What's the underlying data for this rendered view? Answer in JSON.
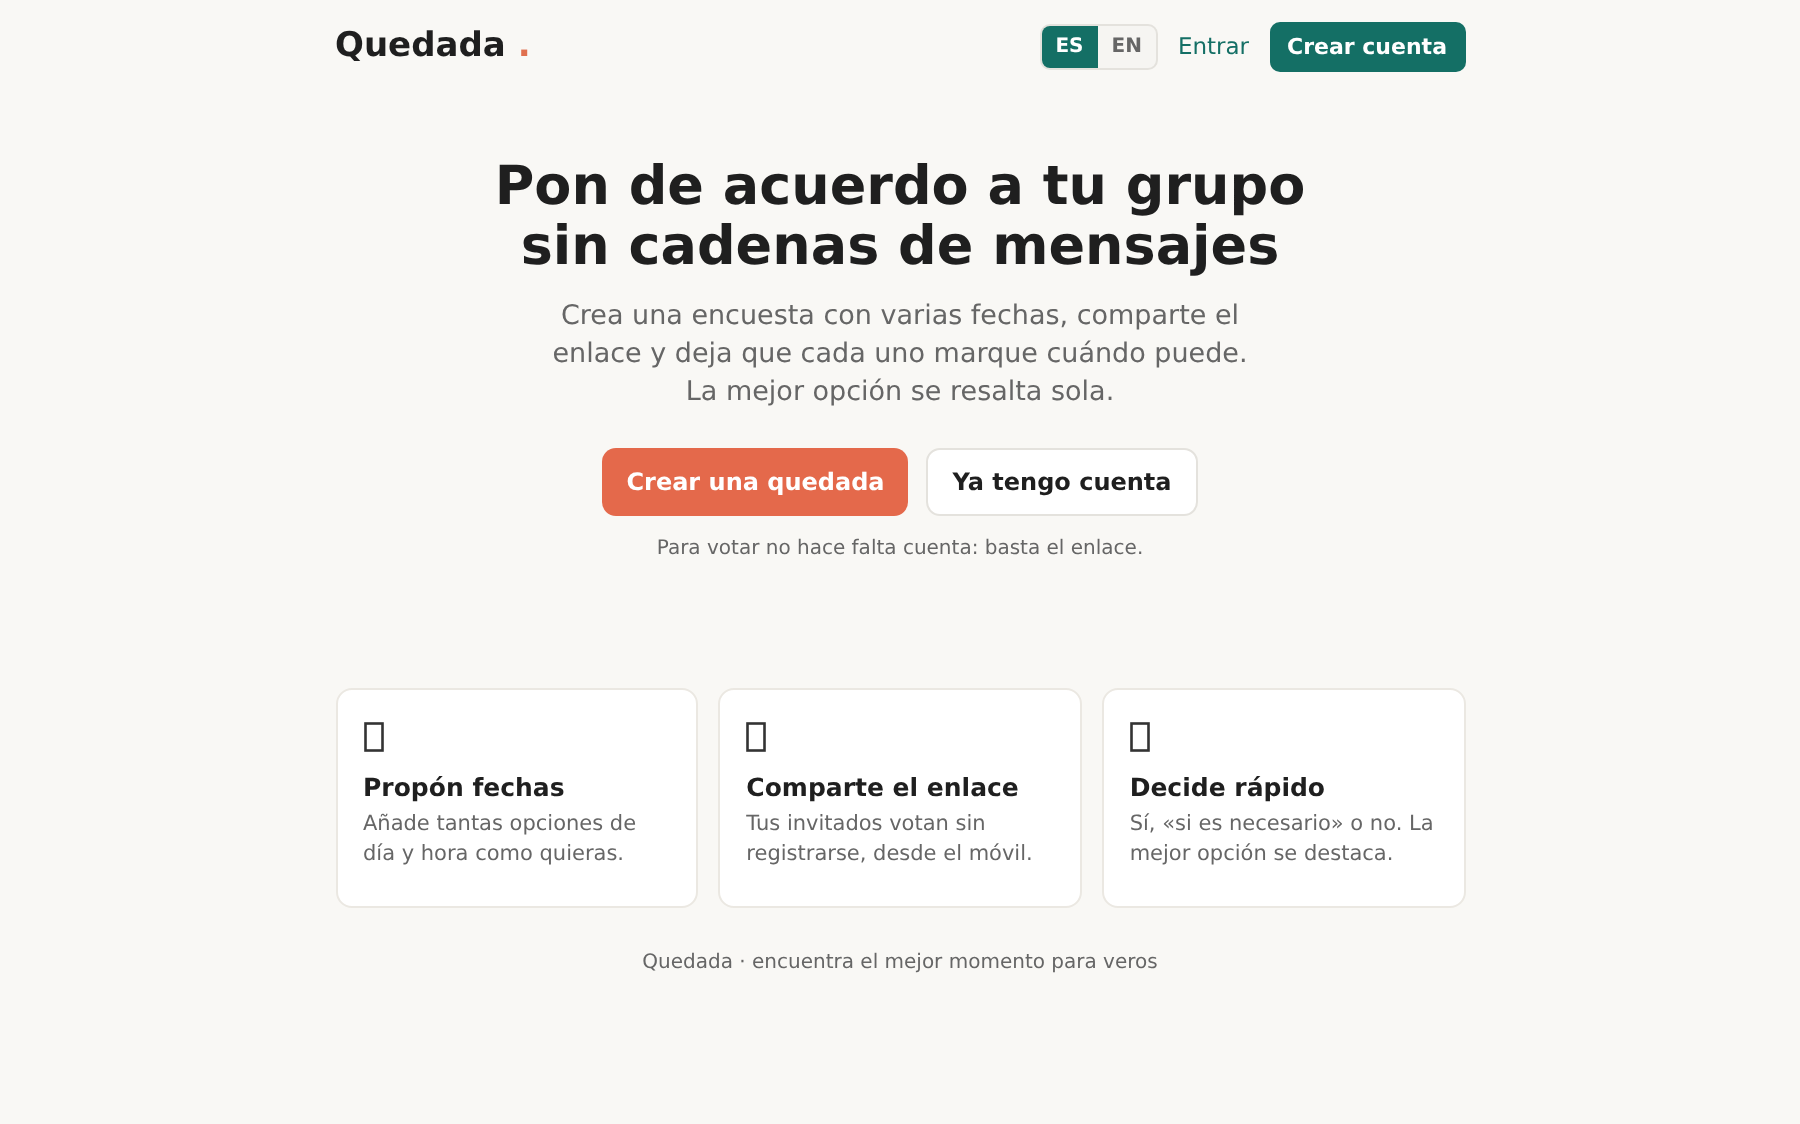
{
  "header": {
    "logo": "Quedada",
    "logo_mark": ".",
    "languages": [
      {
        "label": "ES",
        "selected": true
      },
      {
        "label": "EN",
        "selected": false
      }
    ],
    "login": "Entrar",
    "signup": "Crear cuenta"
  },
  "hero": {
    "title_lines": [
      "Pon de acuerdo a tu grupo",
      "sin cadenas de mensajes"
    ],
    "subtitle": "Crea una encuesta con varias fechas, comparte el enlace y deja que cada uno marque cuándo puede. La mejor opción se resalta sola.",
    "buttons": [
      {
        "label": "Crear una quedada",
        "kind": "primary"
      },
      {
        "label": "Ya tengo cuenta",
        "kind": "secondary"
      }
    ],
    "note": "Para votar no hace falta cuenta: basta el enlace."
  },
  "features": [
    {
      "title": "Propón fechas",
      "text": "Añade tantas opciones de día y hora como quieras."
    },
    {
      "title": "Comparte el enlace",
      "text": "Tus invitados votan sin registrarse, desde el móvil."
    },
    {
      "title": "Decide rápido",
      "text": "Sí, «si es necesario» o no. La mejor opción se destaca."
    }
  ],
  "footer": "Quedada · encuentra el mejor momento para veros"
}
